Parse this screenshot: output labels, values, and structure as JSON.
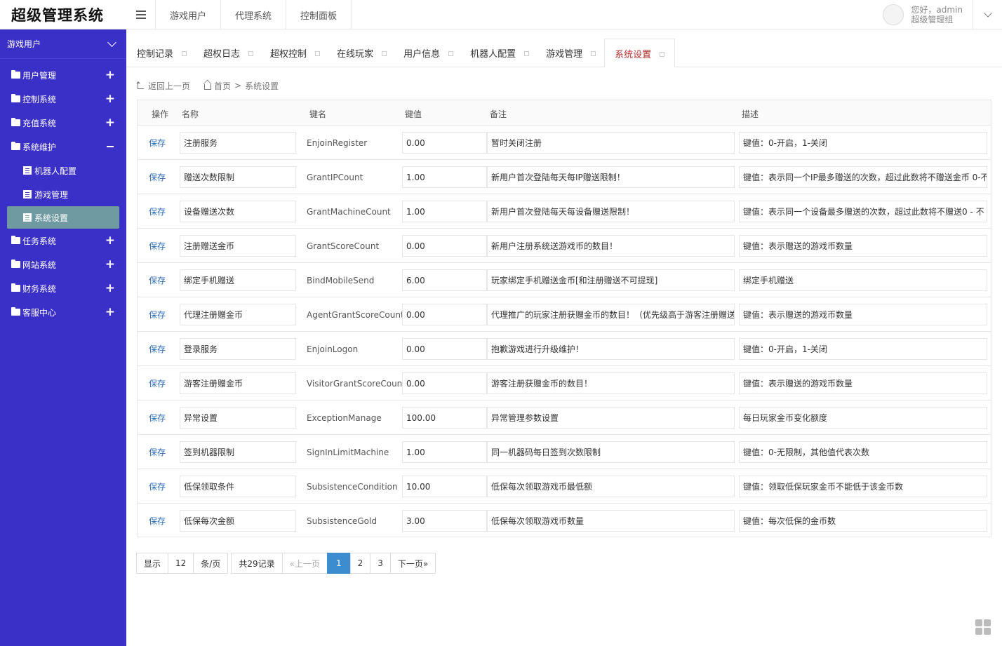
{
  "app": {
    "logo": "超级管理系统"
  },
  "sidebar": {
    "group": "游戏用户",
    "menus": [
      {
        "label": "用户管理",
        "expanded": false
      },
      {
        "label": "控制系统",
        "expanded": false
      },
      {
        "label": "充值系统",
        "expanded": false
      },
      {
        "label": "系统维护",
        "expanded": true
      },
      {
        "label": "任务系统",
        "expanded": false
      },
      {
        "label": "网站系统",
        "expanded": false
      },
      {
        "label": "财务系统",
        "expanded": false
      },
      {
        "label": "客服中心",
        "expanded": false
      }
    ],
    "sub_items": [
      "机器人配置",
      "游戏管理",
      "系统设置"
    ],
    "active_sub": "系统设置"
  },
  "topnav": {
    "items": [
      "游戏用户",
      "代理系统",
      "控制面板"
    ]
  },
  "user": {
    "greeting": "您好，admin",
    "role": "超级管理组"
  },
  "tabs": [
    "控制记录",
    "超权日志",
    "超权控制",
    "在线玩家",
    "用户信息",
    "机器人配置",
    "游戏管理",
    "系统设置"
  ],
  "active_tab": "系统设置",
  "breadcrumb": {
    "back": "返回上一页",
    "home": "首页",
    "sep": ">",
    "current": "系统设置"
  },
  "table": {
    "headers": {
      "op": "操作",
      "name": "名称",
      "key": "键名",
      "value": "键值",
      "note": "备注",
      "desc": "描述"
    },
    "op_label": "保存",
    "rows": [
      {
        "name": "注册服务",
        "key": "EnjoinRegister",
        "value": "0.00",
        "note": "暂时关闭注册",
        "desc": "键值：0-开启，1-关闭"
      },
      {
        "name": "赠送次数限制",
        "key": "GrantIPCount",
        "value": "1.00",
        "note": "新用户首次登陆每天每IP赠送限制！",
        "desc": "键值：表示同一个IP最多赠送的次数，超过此数将不赠送金币 0-不"
      },
      {
        "name": "设备赠送次数",
        "key": "GrantMachineCount",
        "value": "1.00",
        "note": "新用户首次登陆每天每设备赠送限制！",
        "desc": "键值：表示同一个设备最多赠送的次数，超过此数将不赠送0 - 不"
      },
      {
        "name": "注册赠送金币",
        "key": "GrantScoreCount",
        "value": "0.00",
        "note": "新用户注册系统送游戏币的数目！",
        "desc": "键值：表示赠送的游戏币数量"
      },
      {
        "name": "绑定手机赠送",
        "key": "BindMobileSend",
        "value": "6.00",
        "note": "玩家绑定手机赠送金币[和注册赠送不可提现]",
        "desc": "绑定手机赠送"
      },
      {
        "name": "代理注册赠金币",
        "key": "AgentGrantScoreCount",
        "value": "0.00",
        "note": "代理推广的玩家注册获赠金币的数目！（优先级高于游客注册赠送）",
        "desc": "键值：表示赠送的游戏币数量"
      },
      {
        "name": "登录服务",
        "key": "EnjoinLogon",
        "value": "0.00",
        "note": "抱歉游戏进行升级维护！",
        "desc": "键值：0-开启，1-关闭"
      },
      {
        "name": "游客注册赠金币",
        "key": "VisitorGrantScoreCount",
        "value": "0.00",
        "note": "游客注册获赠金币的数目！",
        "desc": "键值：表示赠送的游戏币数量"
      },
      {
        "name": "异常设置",
        "key": "ExceptionManage",
        "value": "100.00",
        "note": "异常管理参数设置",
        "desc": "每日玩家金币变化额度"
      },
      {
        "name": "签到机器限制",
        "key": "SignInLimitMachine",
        "value": "1.00",
        "note": "同一机器码每日签到次数限制",
        "desc": "键值：0-无限制，其他值代表次数"
      },
      {
        "name": "低保领取条件",
        "key": "SubsistenceCondition",
        "value": "10.00",
        "note": "低保每次领取游戏币最低额",
        "desc": "键值：领取低保玩家金币不能低于该金币数"
      },
      {
        "name": "低保每次金额",
        "key": "SubsistenceGold",
        "value": "3.00",
        "note": "低保每次领取游戏币数量",
        "desc": "键值：每次低保的金币数"
      }
    ]
  },
  "pager": {
    "show": "显示",
    "per_page": "12",
    "unit": "条/页",
    "total": "共29记录",
    "prev": "«上一页",
    "pages": [
      "1",
      "2",
      "3"
    ],
    "current": "1",
    "next": "下一页»"
  }
}
